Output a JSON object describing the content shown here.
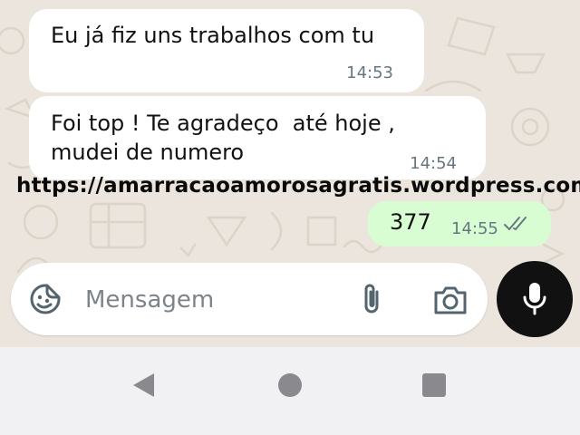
{
  "messages": [
    {
      "direction": "incoming",
      "text": "Eu já fiz uns trabalhos com tu",
      "time": "14:53"
    },
    {
      "direction": "incoming",
      "text": "Foi top ! Te agradeço  até hoje ,\nmudei de numero",
      "time": "14:54"
    },
    {
      "direction": "outgoing",
      "text": "377",
      "time": "14:55",
      "status_icon": "double-check-icon"
    }
  ],
  "watermark": "https://amarracaoamorosagratis.wordpress.com/",
  "composer": {
    "placeholder": "Mensagem",
    "emoji_icon": "sticker-emoji-icon",
    "attach_icon": "paperclip-icon",
    "camera_icon": "camera-icon",
    "mic_icon": "microphone-icon"
  },
  "navigation": {
    "back_icon": "nav-back-icon",
    "home_icon": "nav-home-icon",
    "recent_icon": "nav-recent-apps-icon"
  },
  "colors": {
    "wallpaper": "#ece5dd",
    "incoming_bubble": "#ffffff",
    "outgoing_bubble": "#d9fdd3",
    "mic_button": "#111111",
    "nav_bar": "#f1f1f3"
  }
}
